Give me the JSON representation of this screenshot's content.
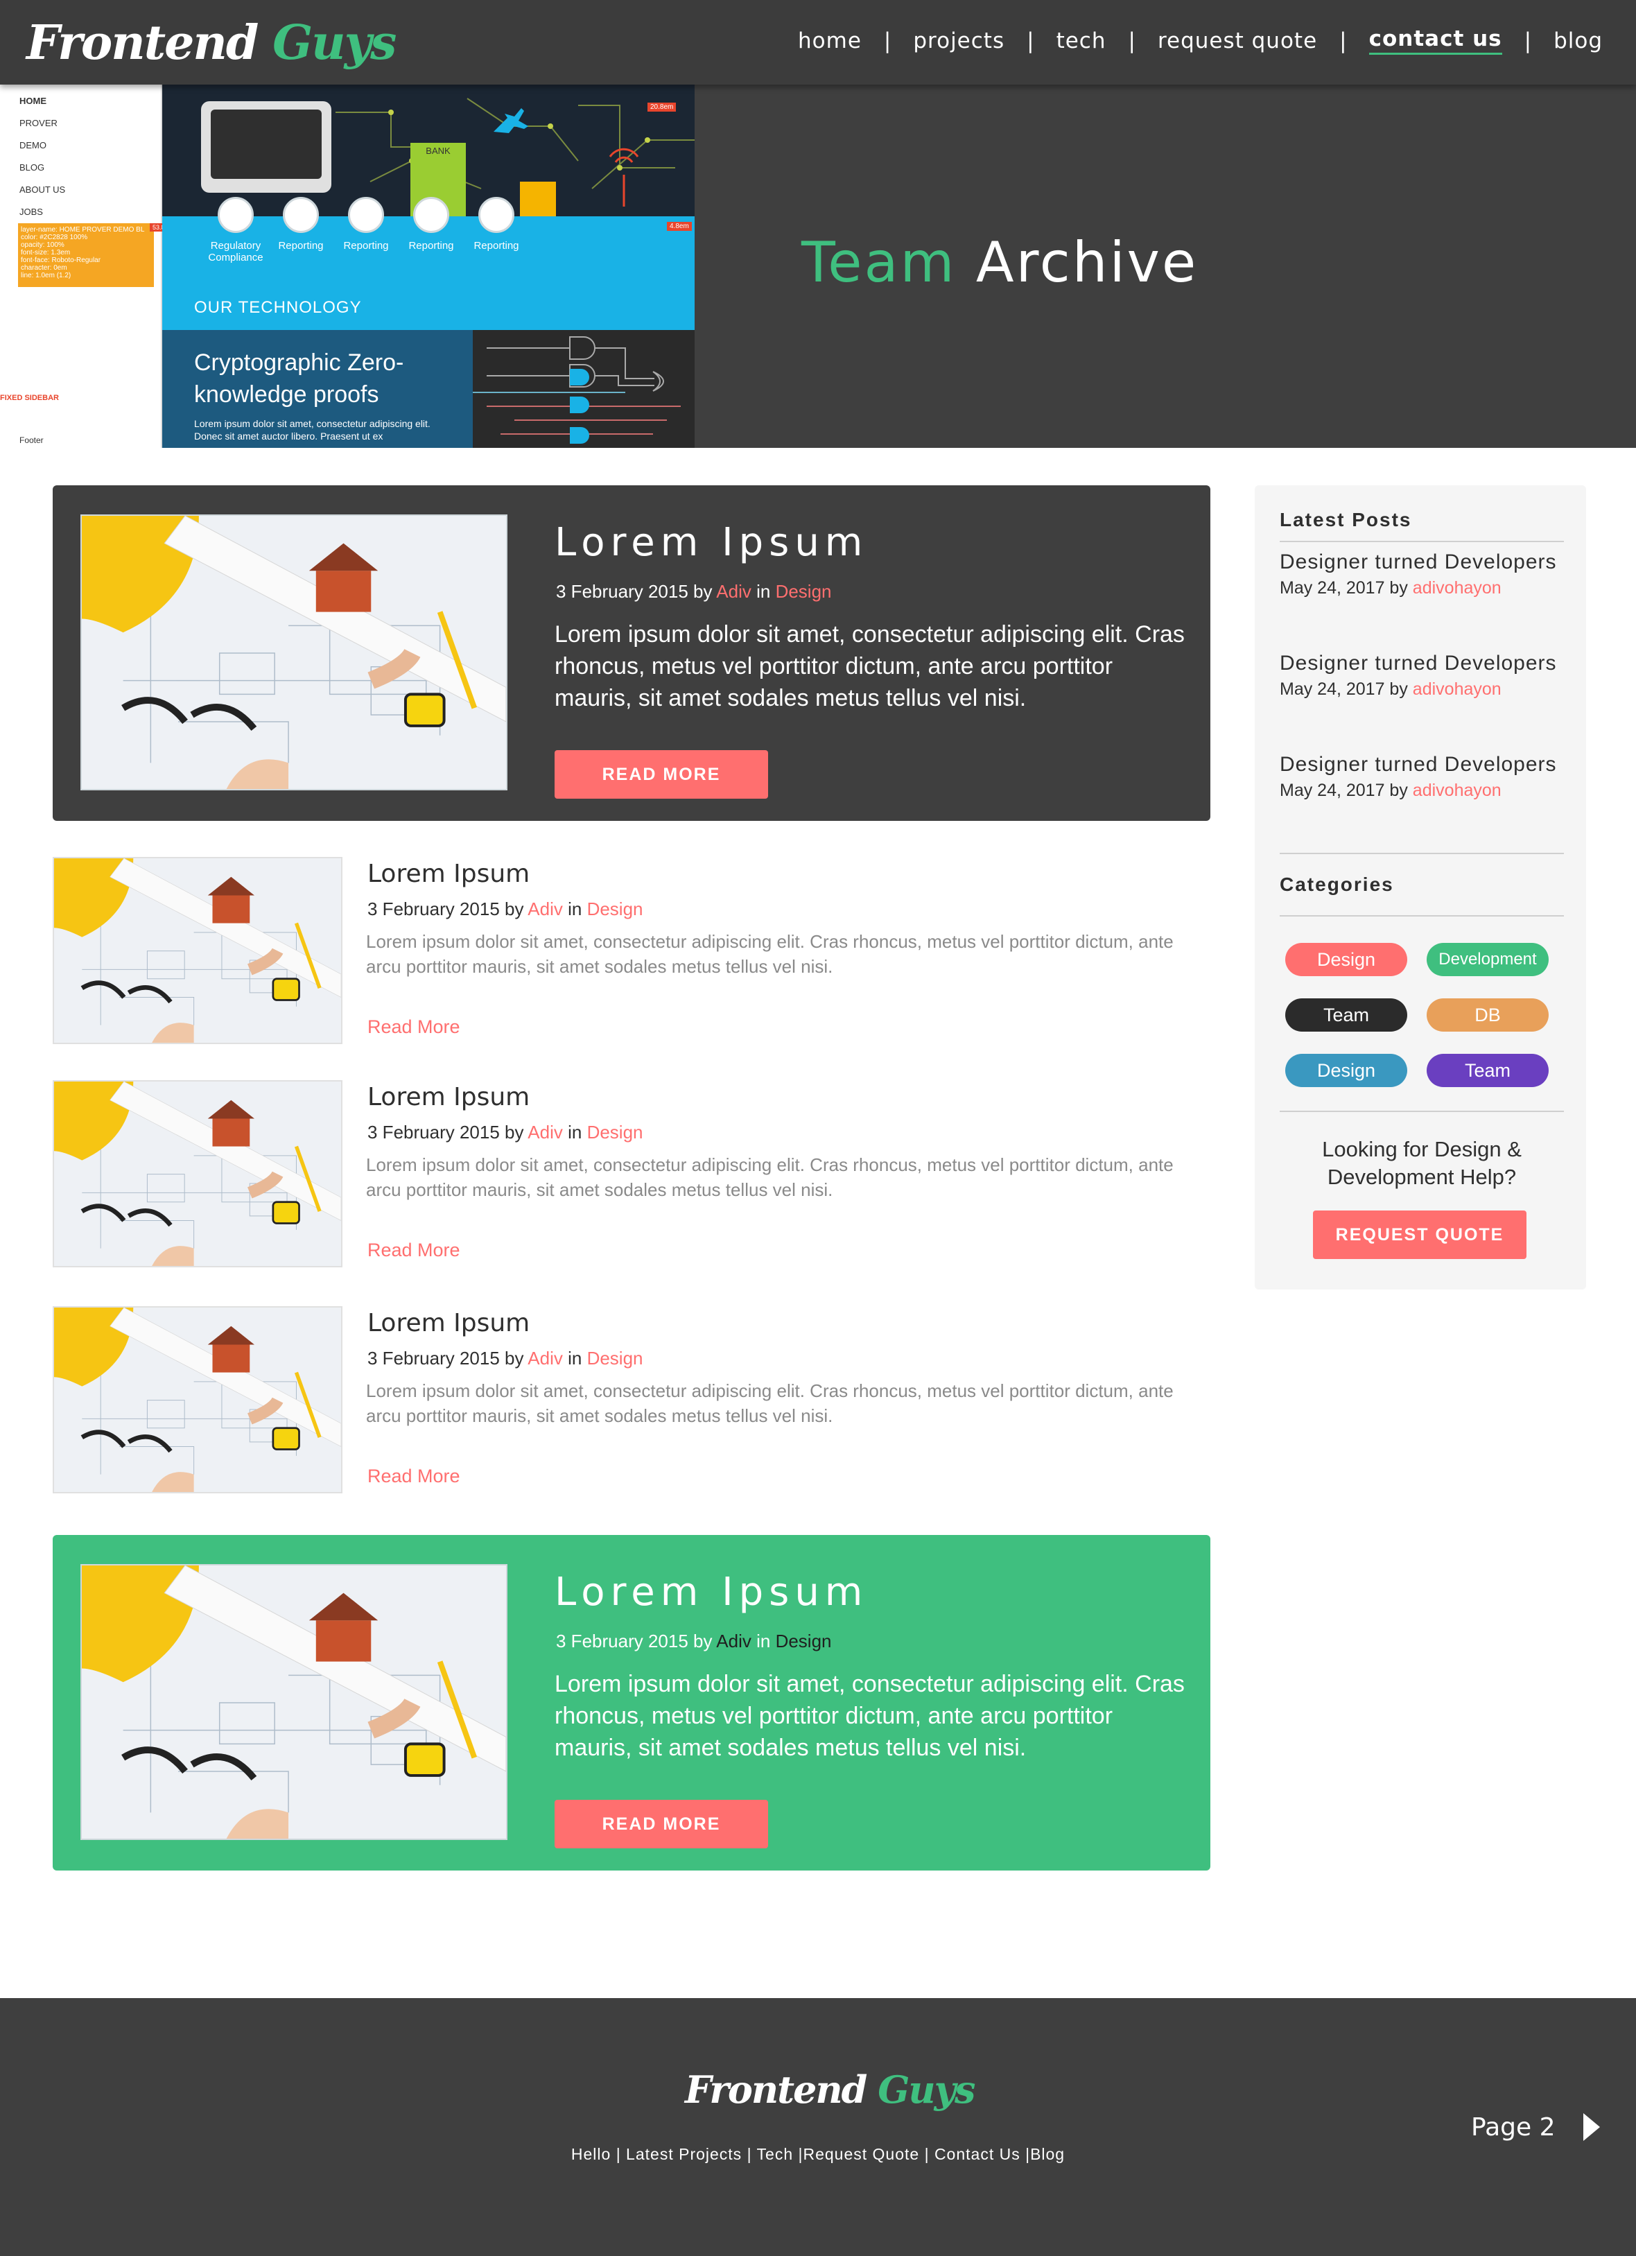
{
  "header": {
    "logo_part1": "Frontend",
    "logo_part2": "Guys",
    "nav": [
      "home",
      "projects",
      "tech",
      "request quote",
      "contact us",
      "blog"
    ],
    "nav_active": "contact us"
  },
  "hero": {
    "title_part1": "Team",
    "title_part2": "Archive",
    "mockup": {
      "sidebar_items": [
        "HOME",
        "PROVER",
        "DEMO",
        "BLOG",
        "ABOUT US",
        "JOBS"
      ],
      "note_lines": [
        "layer-name: HOME PROVER DEMO BL",
        "color: #2C2828 100%",
        "opacity: 100%",
        "font-size: 1.3em",
        "font-face: Roboto-Regular",
        "character: 0em",
        "line: 1.0em (1.2)"
      ],
      "note_tag": "53.8em",
      "fixed_sidebar": "FIXED SIDEBAR",
      "footer_label": "Footer",
      "top_tag": "20.8em",
      "mid_tag": "4.8em",
      "bank": "BANK",
      "reporting": [
        "Regulatory Compliance",
        "Reporting",
        "Reporting",
        "Reporting",
        "Reporting"
      ],
      "tech_label": "OUR TECHNOLOGY",
      "crypto_title": "Cryptographic Zero-knowledge proofs",
      "crypto_text": "Lorem ipsum dolor sit amet, consectetur adipiscing elit. Donec sit amet auctor libero. Praesent ut ex"
    }
  },
  "featured": [
    {
      "title": "Lorem Ipsum",
      "date": "3 February 2015 by",
      "author": "Adiv",
      "in": "in",
      "category": "Design",
      "excerpt": "Lorem ipsum dolor sit amet, consectetur adipiscing elit. Cras rhoncus, metus vel porttitor dictum, ante arcu porttitor mauris, sit amet sodales metus tellus vel nisi.",
      "button": "READ MORE"
    },
    {
      "title": "Lorem Ipsum",
      "date": "3 February 2015 by",
      "author": "Adiv",
      "in": "in",
      "category": "Design",
      "excerpt": "Lorem ipsum dolor sit amet, consectetur adipiscing elit. Cras rhoncus, metus vel porttitor dictum, ante arcu porttitor mauris, sit amet sodales metus tellus vel nisi.",
      "button": "READ MORE"
    }
  ],
  "posts": [
    {
      "title": "Lorem Ipsum",
      "date": "3 February 2015 by",
      "author": "Adiv",
      "in": "in",
      "category": "Design",
      "excerpt": "Lorem ipsum dolor sit amet, consectetur adipiscing elit. Cras rhoncus, metus vel porttitor dictum, ante arcu porttitor mauris, sit amet sodales metus tellus vel nisi.",
      "read_more": "Read More"
    },
    {
      "title": "Lorem Ipsum",
      "date": "3 February 2015 by",
      "author": "Adiv",
      "in": "in",
      "category": "Design",
      "excerpt": "Lorem ipsum dolor sit amet, consectetur adipiscing elit. Cras rhoncus, metus vel porttitor dictum, ante arcu porttitor mauris, sit amet sodales metus tellus vel nisi.",
      "read_more": "Read More"
    },
    {
      "title": "Lorem Ipsum",
      "date": "3 February 2015 by",
      "author": "Adiv",
      "in": "in",
      "category": "Design",
      "excerpt": "Lorem ipsum dolor sit amet, consectetur adipiscing elit. Cras rhoncus, metus vel porttitor dictum, ante arcu porttitor mauris, sit amet sodales metus tellus vel nisi.",
      "read_more": "Read More"
    }
  ],
  "sidebar": {
    "latest_heading": "Latest Posts",
    "latest": [
      {
        "title": "Designer turned Developers",
        "date": "May 24, 2017 by",
        "author": "adivohayon"
      },
      {
        "title": "Designer turned Developers",
        "date": "May 24, 2017 by",
        "author": "adivohayon"
      },
      {
        "title": "Designer turned Developers",
        "date": "May 24, 2017 by",
        "author": "adivohayon"
      }
    ],
    "categories_heading": "Categories",
    "categories": [
      {
        "label": "Design",
        "color": "#ff6f6f"
      },
      {
        "label": "Development",
        "color": "#3fbf7f"
      },
      {
        "label": "Team",
        "color": "#2b2b2b"
      },
      {
        "label": "DB",
        "color": "#e8a05a"
      },
      {
        "label": "Design",
        "color": "#3a98c0"
      },
      {
        "label": "Team",
        "color": "#6a3fc0"
      }
    ],
    "help_text": "Looking for Design & Development Help?",
    "quote_button": "REQUEST QUOTE"
  },
  "footer": {
    "logo_part1": "Frontend",
    "logo_part2": "Guys",
    "links": "Hello | Latest Projects | Tech |Request Quote | Contact Us |Blog",
    "page_label": "Page 2"
  },
  "colors": {
    "accent_green": "#3fbf7f",
    "accent_coral": "#ff6f6f",
    "dark_bg": "#3f3f3f"
  }
}
